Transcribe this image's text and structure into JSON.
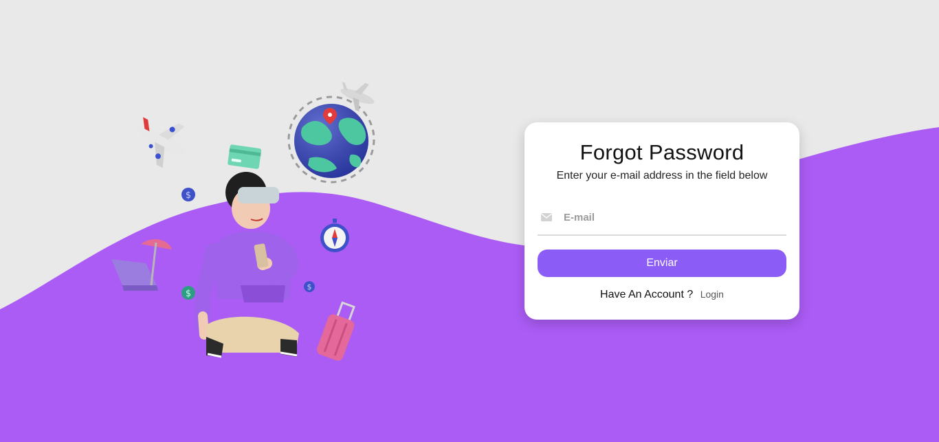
{
  "colors": {
    "page_background": "#e9e9e9",
    "wave_purple": "#ab5cf5",
    "button_purple": "#8b5cf6",
    "card_background": "#ffffff"
  },
  "card": {
    "title": "Forgot Password",
    "subtitle": "Enter your e-mail address in the field below",
    "email_field": {
      "icon": "envelope-icon",
      "placeholder": "E-mail",
      "value": ""
    },
    "submit_label": "Enviar",
    "account_prompt": "Have An Account ?",
    "login_link": "Login"
  },
  "illustration": {
    "icons": [
      "airplane-icon",
      "airplane-icon",
      "globe-icon",
      "credit-card-icon",
      "dollar-coin-icon",
      "compass-icon",
      "beach-chair-icon",
      "suitcase-icon",
      "vr-headset-person"
    ]
  }
}
